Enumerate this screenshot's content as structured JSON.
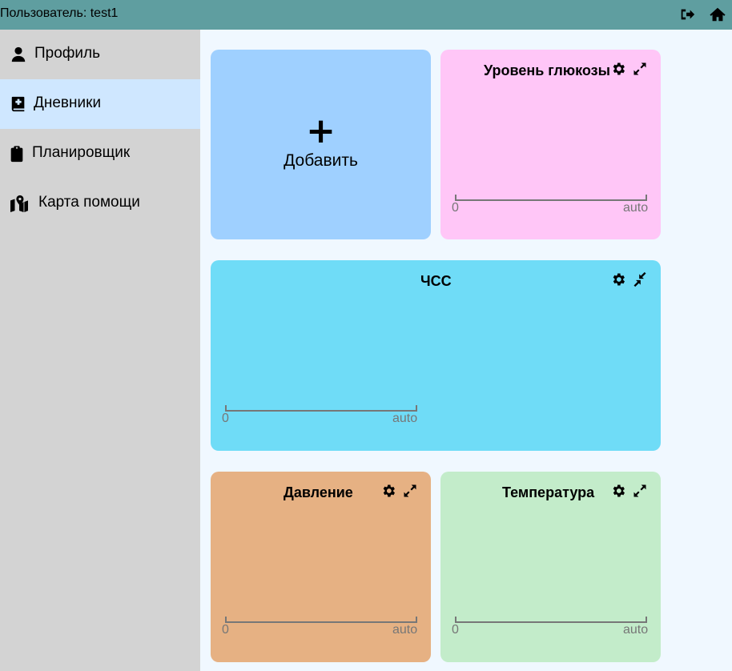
{
  "topbar": {
    "user_label": "Пользователь: test1",
    "logout_icon": "sign-out-icon",
    "home_icon": "home-icon"
  },
  "sidebar": {
    "items": [
      {
        "label": "Профиль",
        "icon": "user-icon"
      },
      {
        "label": "Дневники",
        "icon": "diary-icon",
        "active": true
      },
      {
        "label": "Планировщик",
        "icon": "clipboard-icon"
      },
      {
        "label": "Карта помощи",
        "icon": "map-icon"
      }
    ]
  },
  "add_card": {
    "plus": "+",
    "label": "Добавить",
    "color": "#9fd0ff"
  },
  "cards": [
    {
      "title": "Уровень глюкозы",
      "color": "#ffc6f7",
      "axis_min": "0",
      "axis_max": "auto"
    },
    {
      "title": "ЧСС",
      "color": "#6fdcf7",
      "axis_min": "0",
      "axis_max": "auto"
    },
    {
      "title": "Давление",
      "color": "#e6b183",
      "axis_min": "0",
      "axis_max": "auto"
    },
    {
      "title": "Температура",
      "color": "#c3ecca",
      "axis_min": "0",
      "axis_max": "auto"
    }
  ]
}
